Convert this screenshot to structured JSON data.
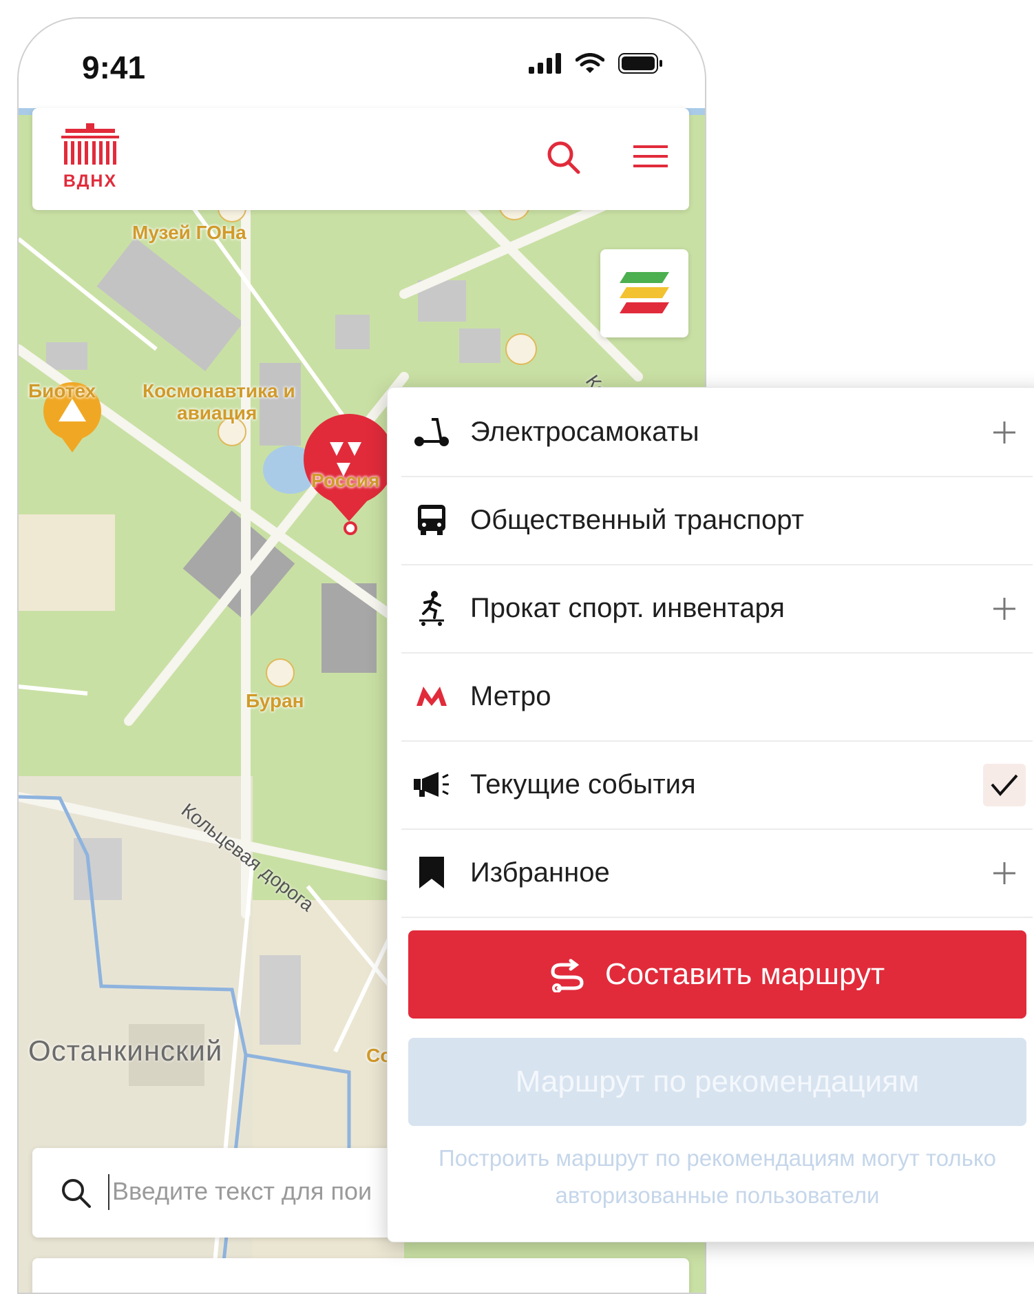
{
  "status_bar": {
    "time": "9:41"
  },
  "header": {
    "logo_text": "ВДНХ"
  },
  "map": {
    "labels": [
      "Музей ГОНа",
      "Биотех",
      "Космонавтика и",
      "авиация",
      "Россия",
      "Буран"
    ],
    "streets": [
      "Кольцевая дорога",
      "Кол"
    ],
    "district": "Останкинский",
    "partial_label": "Со"
  },
  "search": {
    "placeholder": "Введите текст для пои"
  },
  "layers_panel": {
    "items": [
      {
        "label": "Электросамокаты",
        "icon": "scooter-icon",
        "state": "add"
      },
      {
        "label": "Общественный транспорт",
        "icon": "bus-icon",
        "state": "none"
      },
      {
        "label": "Прокат спорт. инвентаря",
        "icon": "skateboard-icon",
        "state": "add"
      },
      {
        "label": "Метро",
        "icon": "metro-icon",
        "state": "none"
      },
      {
        "label": "Текущие события",
        "icon": "megaphone-icon",
        "state": "checked"
      },
      {
        "label": "Избранное",
        "icon": "bookmark-icon",
        "state": "add"
      }
    ],
    "route_button": "Составить маршрут",
    "recommendations_button": "Маршрут по рекомендациям",
    "hint": "Построить маршрут по рекомендациям могут только авторизованные пользователи"
  },
  "colors": {
    "accent": "#e12b3b",
    "map_green": "#c9e0a4",
    "map_label": "#d19a2a",
    "disabled": "#d8e3f0"
  }
}
